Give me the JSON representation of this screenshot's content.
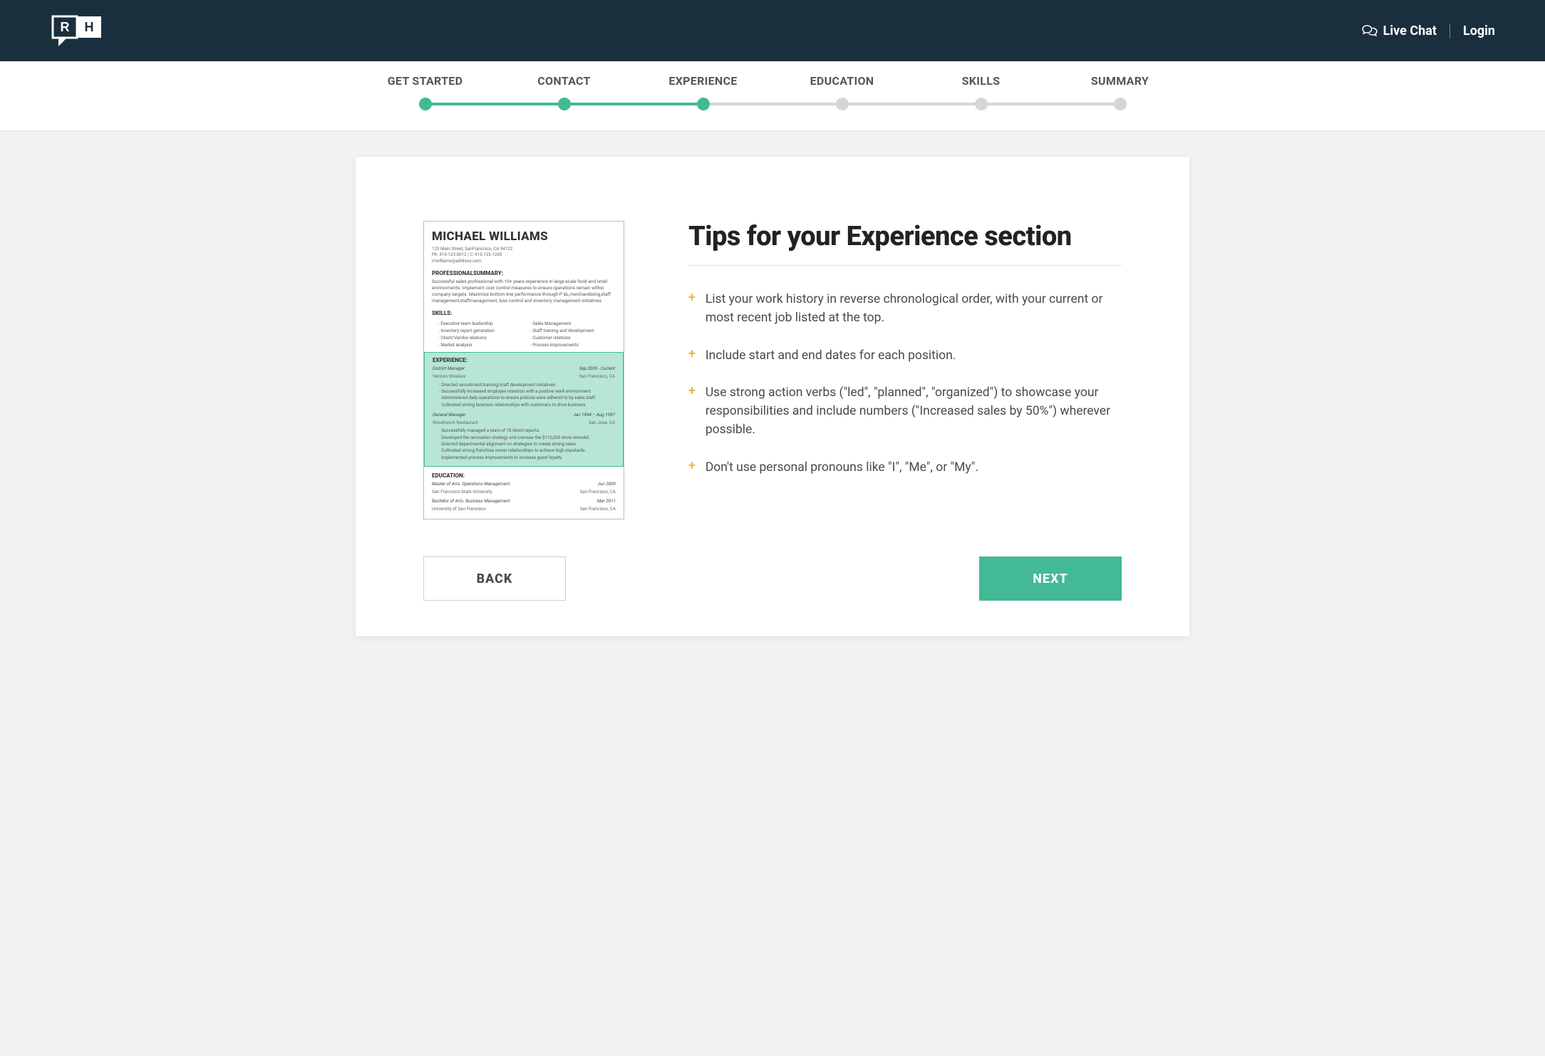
{
  "header": {
    "live_chat": "Live Chat",
    "login": "Login"
  },
  "stepper": {
    "steps": [
      {
        "label": "GET STARTED",
        "state": "done"
      },
      {
        "label": "CONTACT",
        "state": "done"
      },
      {
        "label": "EXPERIENCE",
        "state": "done"
      },
      {
        "label": "EDUCATION",
        "state": "todo"
      },
      {
        "label": "SKILLS",
        "state": "todo"
      },
      {
        "label": "SUMMARY",
        "state": "todo"
      }
    ]
  },
  "resume": {
    "name": "MICHAEL WILLIAMS",
    "address": "123 Main Street, SanFrancisco, CA 94122",
    "phone": "Ph: 415-123-0012 | C: 415-123-1200",
    "email": "mwilliams@address.com",
    "summary_heading": "PROFESSIONALSUMMARY:",
    "summary_text": "Successful sales professional with 10+ years experience in large-scale food and retail environments. Implement cost control measures to ensure operations remain within company targets. Maximize bottom-line performance through P &L,merchandising,staff management,staffmanagement, loss control and inventory management initiatives.",
    "skills_heading": "SKILLS:",
    "skills_left": [
      "Executive team leadership",
      "Inventory report generation",
      "Client/Vendor relations",
      "Market analysis"
    ],
    "skills_right": [
      "Sales Management",
      "Staff training and development",
      "Customer relations",
      "Process improvements"
    ],
    "experience_heading": "EXPERIENCE:",
    "job1": {
      "title": "District Manager",
      "dates": "Sep 2009 - Current",
      "company": "Verizon Wireless",
      "location": "San Francisco, CA",
      "bullets": [
        "Directed recruitment/training/staff development initiatives.",
        "Successfully increased employee retention with a positive work environment.",
        "Administered daily operations to ensure policies were adhered to by sales staff.",
        "Cultivated strong business relationships with customers to drive business."
      ]
    },
    "job2": {
      "title": "General Manager",
      "dates": "Jan 1994 – Aug 1997",
      "company": "Woodranch Restaurant",
      "location": "San Jose, CA",
      "bullets": [
        "Successfully managed a team of 18 direct reports.",
        "Developed the renovation strategy and oversaw the $110,000 store remodel.",
        "Directed departmental alignment on strategies to create strong sales.",
        "Cultivated strong franchise owner relationships to achieve high standards.",
        "Implemented process improvements to increase guest loyalty."
      ]
    },
    "education_heading": "EDUCATION:",
    "edu1": {
      "degree": "Master of Arts: Operations Management",
      "date": "Jun 2009",
      "school": "San Francisco State University",
      "loc": "San Francisco, CA"
    },
    "edu2": {
      "degree": "Bachelor of Arts: Business Management",
      "date": "Mar 2011",
      "school": "University of San Francisco",
      "loc": "San Francisco, CA"
    }
  },
  "tips": {
    "heading": "Tips for your Experience section",
    "items": [
      "List your work history in reverse chronological order, with your current or most recent job listed at the top.",
      "Include start and end dates for each position.",
      "Use strong action verbs (\"led\", \"planned\", \"organized\") to showcase your responsibilities and include numbers (\"Increased sales by 50%\") wherever possible.",
      "Don't use personal pronouns like \"I\", \"Me\", or \"My\"."
    ]
  },
  "buttons": {
    "back": "BACK",
    "next": "NEXT"
  }
}
